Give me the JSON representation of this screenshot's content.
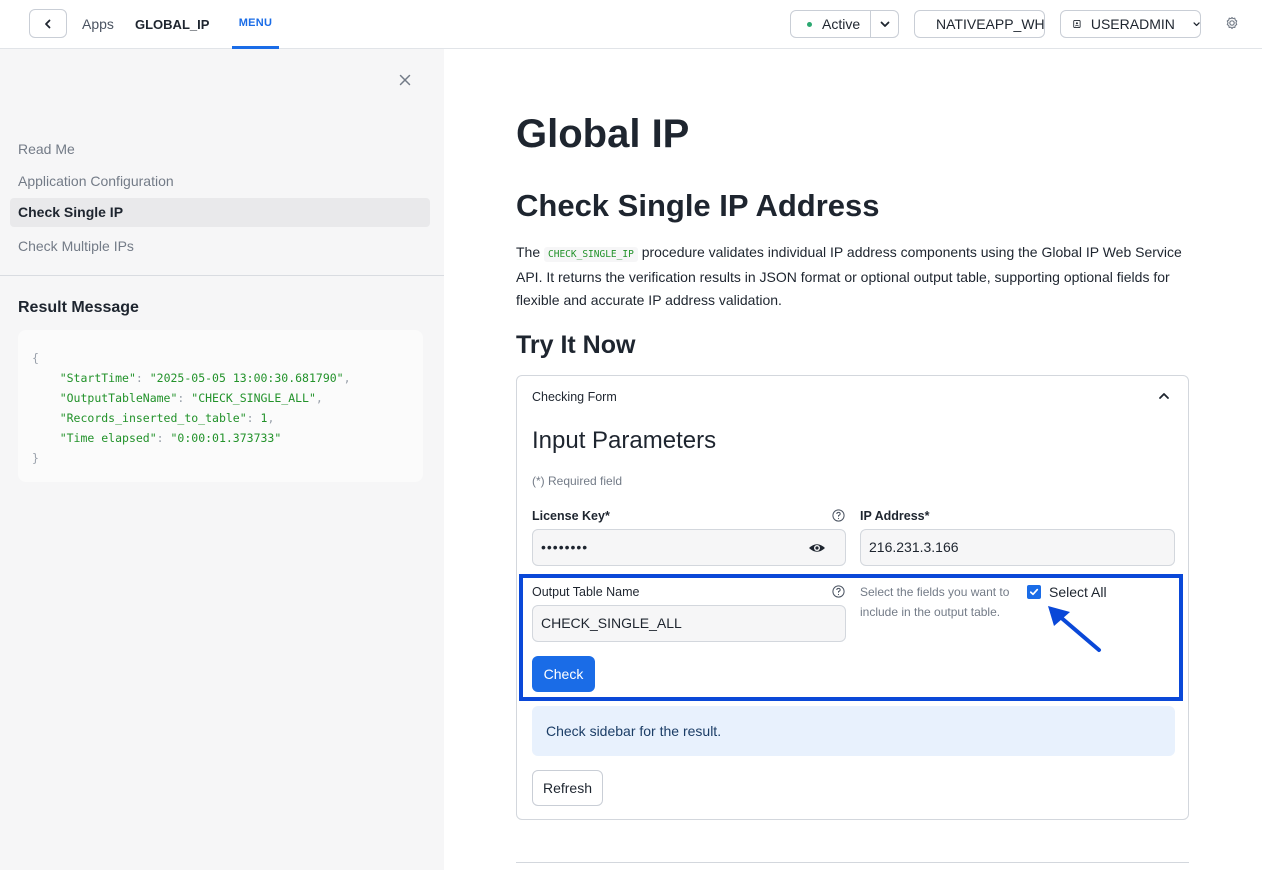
{
  "topbar": {
    "apps_label": "Apps",
    "app_name": "GLOBAL_IP",
    "menu_tab": "MENU",
    "status": "Active",
    "warehouse": "NATIVEAPP_WH",
    "user": "USERADMIN",
    "icons": [
      "chevron-left-icon",
      "chevron-down-icon",
      "badge-icon",
      "gear-icon"
    ],
    "status_color": "#2ba871"
  },
  "sidebar": {
    "items": [
      {
        "label": "Read Me",
        "active": false
      },
      {
        "label": "Application Configuration",
        "active": false
      },
      {
        "label": "Check Single IP",
        "active": true
      },
      {
        "label": "Check Multiple IPs",
        "active": false
      }
    ],
    "result_title": "Result Message",
    "result_lines": {
      "open": "{",
      "k1": "\"StartTime\"",
      "v1": "\"2025-05-05 13:00:30.681790\"",
      "k2": "\"OutputTableName\"",
      "v2": "\"CHECK_SINGLE_ALL\"",
      "k3": "\"Records_inserted_to_table\"",
      "v3": "1",
      "k4": "\"Time elapsed\"",
      "v4": "\"0:00:01.373733\"",
      "close": "}"
    }
  },
  "main": {
    "title": "Global IP",
    "subtitle": "Check Single IP Address",
    "desc_pre": "The ",
    "desc_code": "CHECK_SINGLE_IP",
    "desc_post": " procedure validates individual IP address components using the Global IP Web Service API. It returns the verification results in JSON format or optional output table, supporting optional fields for flexible and accurate IP address validation.",
    "try_title": "Try It Now",
    "form": {
      "header": "Checking Form",
      "title": "Input Parameters",
      "required_note": "(*) Required field",
      "license_label": "License Key*",
      "license_value": "••••••••",
      "ip_label": "IP Address*",
      "ip_value": "216.231.3.166",
      "output_label": "Output Table Name",
      "output_value": "CHECK_SINGLE_ALL",
      "fields_helper": "Select the fields you want to include in the output table.",
      "select_all_label": "Select All",
      "select_all_checked": true,
      "check_button": "Check",
      "info_message": "Check sidebar for the result.",
      "refresh_button": "Refresh"
    },
    "accent": "#1a6ce7",
    "highlight_color": "#0a48d8"
  }
}
